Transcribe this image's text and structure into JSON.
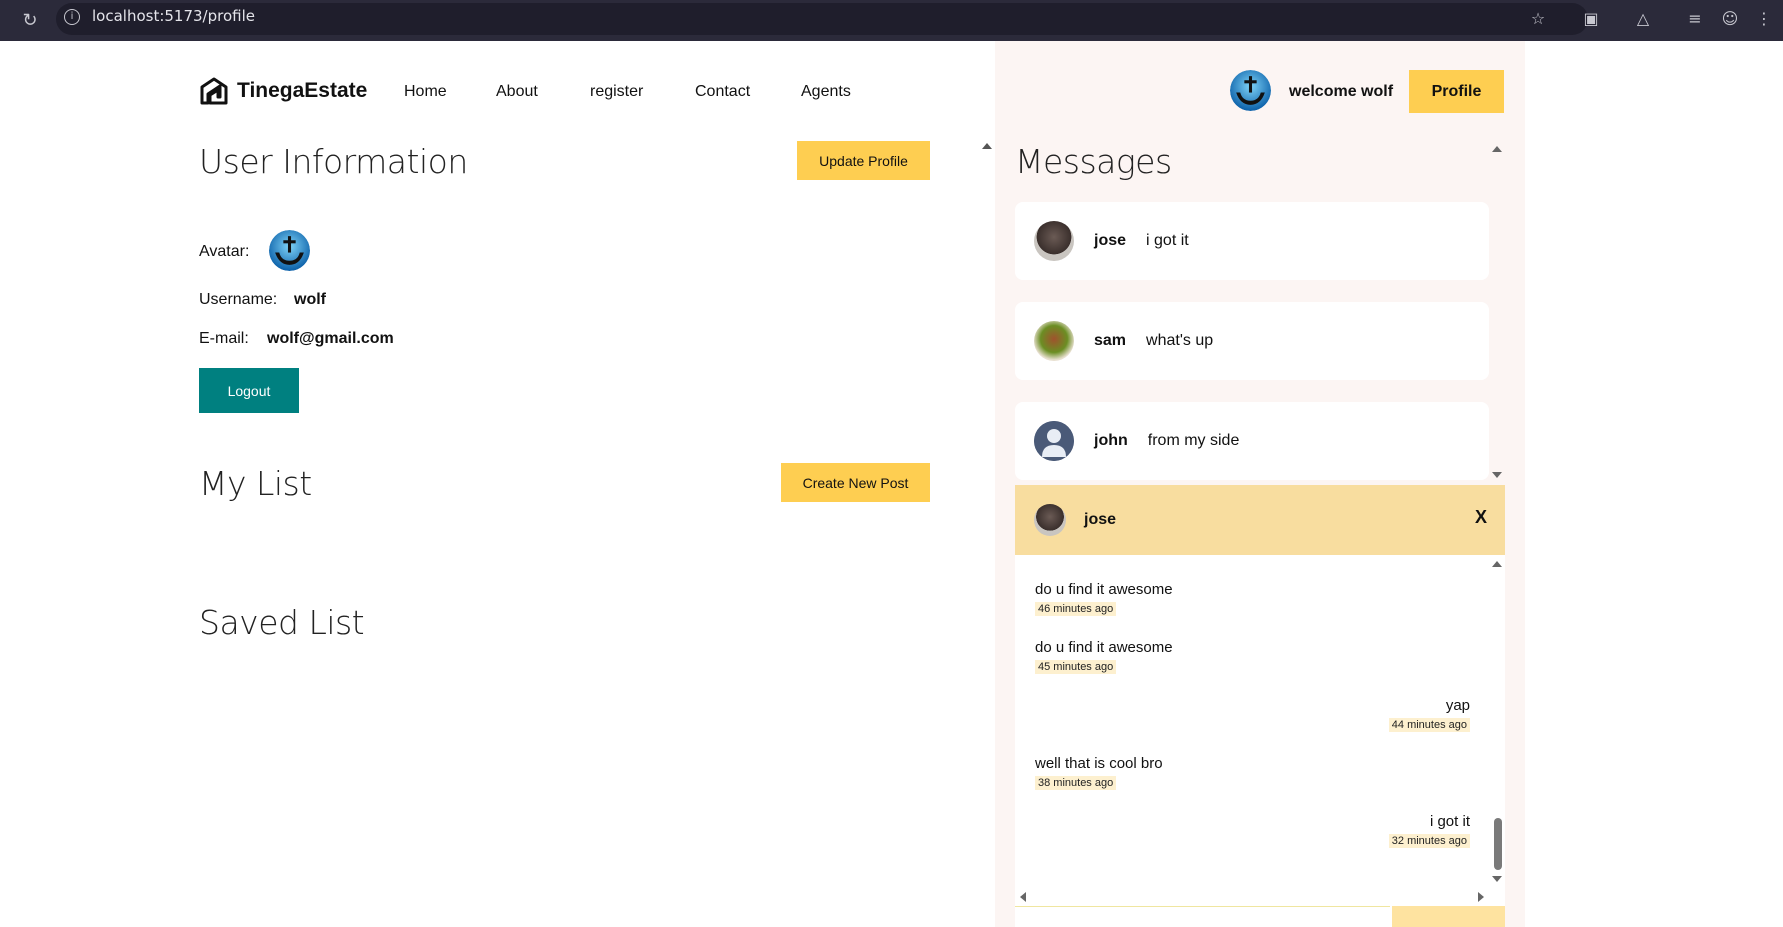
{
  "browser": {
    "url": "localhost:5173/profile"
  },
  "header": {
    "logo_text": "TinegaEstate",
    "nav": [
      "Home",
      "About",
      "register",
      "Contact",
      "Agents"
    ],
    "welcome_text": "welcome wolf",
    "profile_button": "Profile"
  },
  "user_info": {
    "title": "User Information",
    "update_button": "Update Profile",
    "avatar_label": "Avatar:",
    "username_label": "Username:",
    "username": "wolf",
    "email_label": "E-mail:",
    "email": "wolf@gmail.com",
    "logout_button": "Logout"
  },
  "my_list": {
    "title": "My List",
    "create_button": "Create New Post"
  },
  "saved_list": {
    "title": "Saved List"
  },
  "messages": {
    "title": "Messages",
    "items": [
      {
        "name": "jose",
        "text": "i got it"
      },
      {
        "name": "sam",
        "text": "what's up"
      },
      {
        "name": "john",
        "text": "from my side"
      }
    ]
  },
  "chat": {
    "name": "jose",
    "close": "X",
    "messages": [
      {
        "text": "do u find it awesome",
        "time": "46 minutes ago",
        "own": false
      },
      {
        "text": "do u find it awesome",
        "time": "45 minutes ago",
        "own": false
      },
      {
        "text": "yap",
        "time": "44 minutes ago",
        "own": true
      },
      {
        "text": "well that is cool bro",
        "time": "38 minutes ago",
        "own": false
      },
      {
        "text": "i got it",
        "time": "32 minutes ago",
        "own": true
      }
    ]
  },
  "colors": {
    "accent_yellow": "#fece51",
    "teal": "#008080",
    "panel_bg": "#fcf5f3",
    "chat_header": "#f8dd9f"
  }
}
